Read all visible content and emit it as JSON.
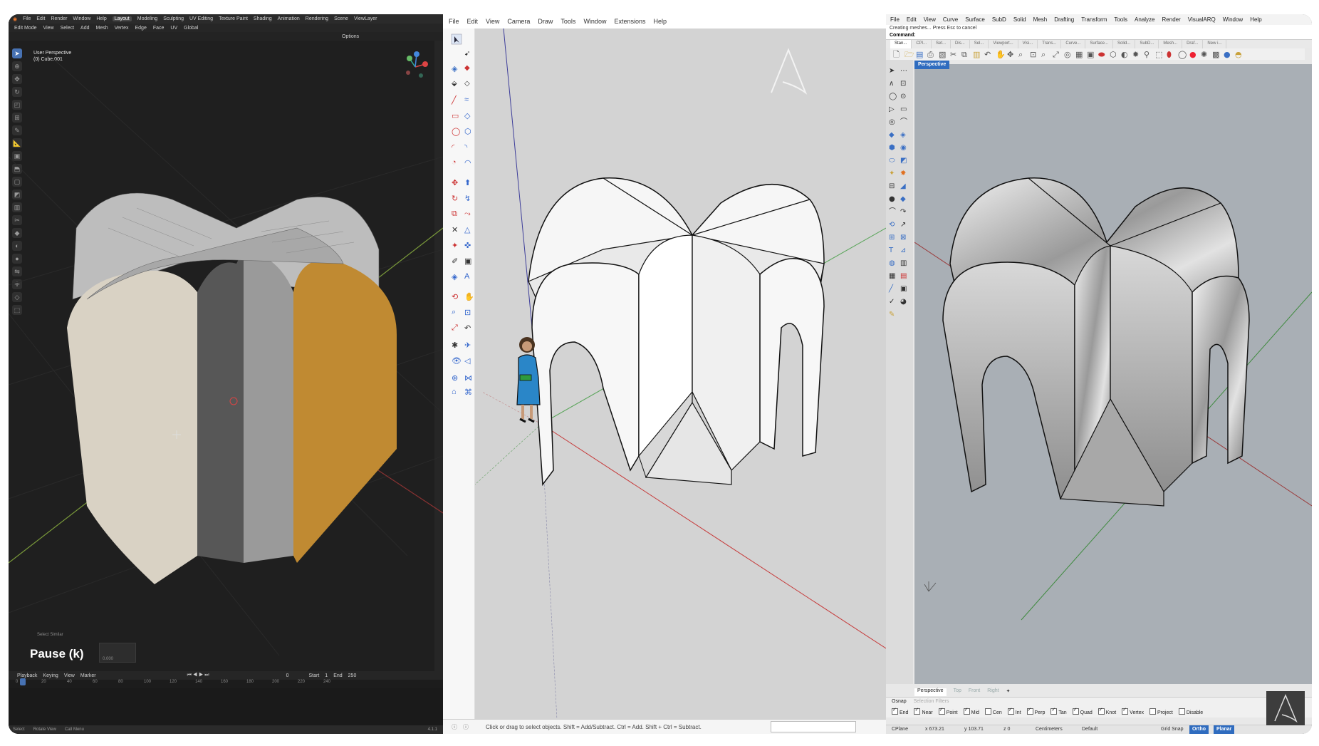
{
  "blender": {
    "menu": [
      "File",
      "Edit",
      "Render",
      "Window",
      "Help",
      "Layout",
      "Modeling",
      "Sculpting",
      "UV Editing",
      "Texture Paint",
      "Shading",
      "Animation",
      "Rendering",
      "Scene",
      "ViewLayer"
    ],
    "header2": [
      "Edit Mode",
      "View",
      "Select",
      "Add",
      "Mesh",
      "Vertex",
      "Edge",
      "Face",
      "UV",
      "Global",
      "Options"
    ],
    "viewport_title": "User Perspective",
    "viewport_object": "(0) Cube.001",
    "last_operator": "Select Similar",
    "pause_label": "Pause (k)",
    "pause_value": "0.000",
    "timeline": [
      "Playback",
      "Keying",
      "View",
      "Marker",
      "0",
      "Start",
      "1",
      "End",
      "250"
    ],
    "ruler": [
      "0",
      "20",
      "40",
      "60",
      "80",
      "100",
      "120",
      "140",
      "160",
      "180",
      "200",
      "220",
      "240"
    ],
    "status": [
      "Select",
      "Rotate View",
      "Call Menu"
    ],
    "version": "4.1.1"
  },
  "sketchup": {
    "menu": [
      "File",
      "Edit",
      "View",
      "Camera",
      "Draw",
      "Tools",
      "Window",
      "Extensions",
      "Help"
    ],
    "status_hint": "Click or drag to select objects. Shift = Add/Subtract. Ctrl = Add. Shift + Ctrl = Subtract."
  },
  "rhino": {
    "menu": [
      "File",
      "Edit",
      "View",
      "Curve",
      "Surface",
      "SubD",
      "Solid",
      "Mesh",
      "Drafting",
      "Transform",
      "Tools",
      "Analyze",
      "Render",
      "VisualARQ",
      "Window",
      "Help"
    ],
    "command_history": "Creating meshes... Press Esc to cancel",
    "command_prompt": "Command:",
    "tabs": [
      "Stan...",
      "CPl...",
      "Set...",
      "Dis...",
      "Sel...",
      "Viewport...",
      "Visi...",
      "Trans...",
      "Curve...",
      "Surface...",
      "Solid...",
      "SubD...",
      "Mesh...",
      "Draf...",
      "New i..."
    ],
    "viewport_label": "Perspective",
    "viewport_tabs": [
      "Perspective",
      "Top",
      "Front",
      "Right"
    ],
    "osnap_tabs": [
      "Osnap",
      "Selection Filters"
    ],
    "osnap": [
      {
        "label": "End",
        "on": true
      },
      {
        "label": "Near",
        "on": true
      },
      {
        "label": "Point",
        "on": true
      },
      {
        "label": "Mid",
        "on": true
      },
      {
        "label": "Cen",
        "on": false
      },
      {
        "label": "Int",
        "on": true
      },
      {
        "label": "Perp",
        "on": true
      },
      {
        "label": "Tan",
        "on": true
      },
      {
        "label": "Quad",
        "on": true
      },
      {
        "label": "Knot",
        "on": true
      },
      {
        "label": "Vertex",
        "on": true
      },
      {
        "label": "Project",
        "on": false
      },
      {
        "label": "Disable",
        "on": false
      }
    ],
    "status": {
      "cplane": "CPlane",
      "x": "x 673.21",
      "y": "y 103.71",
      "z": "z 0",
      "units": "Centimeters",
      "layer": "Default",
      "grid_snap": "Grid Snap",
      "ortho": "Ortho",
      "planar": "Planar"
    }
  },
  "colors": {
    "blender_bg": "#1f1f1f",
    "blender_accent": "#4772b3",
    "sketchup_canvas": "#d3d3d3",
    "rhino_viewport": "#a9afb5",
    "rhino_accent": "#2f6cbf",
    "face_orange": "#c08a32"
  }
}
